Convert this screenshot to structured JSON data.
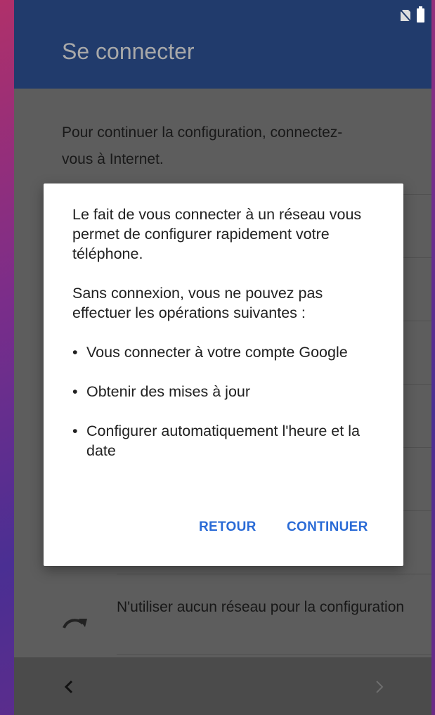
{
  "header": {
    "title": "Se connecter"
  },
  "main": {
    "intro": "Pour continuer la configuration, connectez-vous à Internet.",
    "no_network_label": "N'utiliser aucun réseau pour la configuration"
  },
  "dialog": {
    "paragraph1": "Le fait de vous connecter à un réseau vous permet de configurer rapidement votre téléphone.",
    "paragraph2": "Sans connexion, vous ne pouvez pas effectuer les opérations suivantes :",
    "bullets": [
      "Vous connecter à votre compte Google",
      "Obtenir des mises à jour",
      "Configurer automatiquement l'heure et la date"
    ],
    "back_label": "RETOUR",
    "continue_label": "CONTINUER"
  },
  "icons": {
    "status": [
      "no-sim-icon",
      "battery-icon"
    ],
    "skip": "redo-arrow-icon",
    "nav_back": "chevron-left-icon",
    "nav_next": "chevron-right-icon"
  },
  "colors": {
    "app_bar": "#213b6c",
    "accent": "#2a6bd6",
    "scrim_background": "#5d5d5d"
  }
}
